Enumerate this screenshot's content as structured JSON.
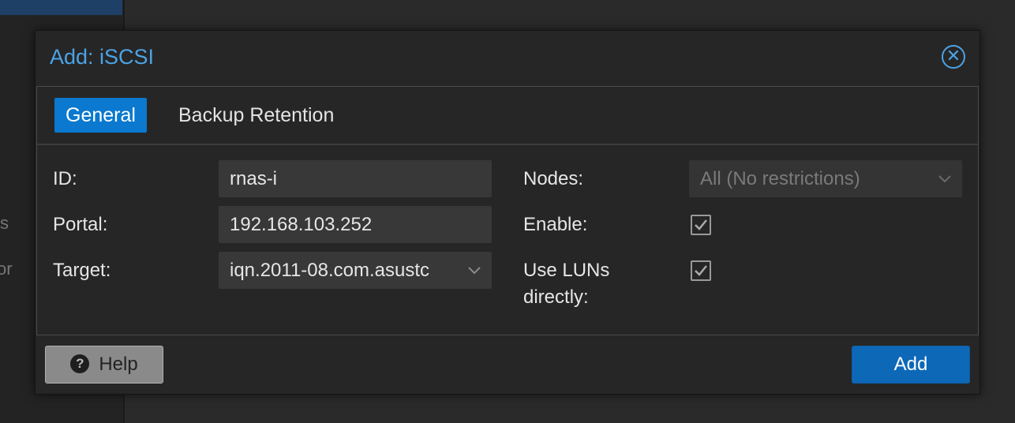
{
  "background": {
    "side_texts": [
      "s",
      "or"
    ]
  },
  "dialog": {
    "title": "Add: iSCSI",
    "close_icon": "close-circle-icon",
    "tabs": [
      {
        "label": "General",
        "active": true
      },
      {
        "label": "Backup Retention",
        "active": false
      }
    ],
    "form": {
      "id_label": "ID:",
      "id_value": "rnas-i",
      "portal_label": "Portal:",
      "portal_value": "192.168.103.252",
      "target_label": "Target:",
      "target_value": "iqn.2011-08.com.asustc",
      "nodes_label": "Nodes:",
      "nodes_value": "All (No restrictions)",
      "enable_label": "Enable:",
      "enable_checked": true,
      "use_luns_label_line1": "Use LUNs",
      "use_luns_label_line2": "directly:",
      "use_luns_checked": true
    },
    "footer": {
      "help_label": "Help",
      "add_label": "Add"
    }
  },
  "colors": {
    "accent": "#4ba3e6",
    "tab_active": "#0a79cf",
    "primary_button": "#0d68b8"
  }
}
